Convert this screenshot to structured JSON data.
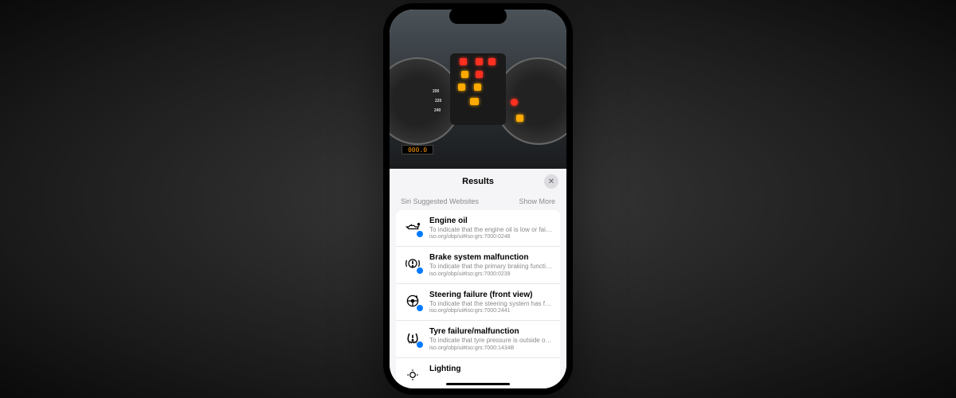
{
  "sheet": {
    "title": "Results",
    "section_label": "Siri Suggested Websites",
    "show_more": "Show More"
  },
  "dashboard": {
    "odometer": "000.0",
    "ticks_left": [
      "200",
      "220",
      "240"
    ]
  },
  "results": [
    {
      "title": "Engine oil",
      "desc": "To indicate that the engine oil is low or fails...",
      "url": "iso.org/obp/ui#iso:grs:7000:0248"
    },
    {
      "title": "Brake system malfunction",
      "desc": "To indicate that the primary braking function...",
      "url": "iso.org/obp/ui#iso:grs:7000:0239"
    },
    {
      "title": "Steering failure (front view)",
      "desc": "To indicate that the steering system has fail...",
      "url": "iso.org/obp/ui#iso:grs:7000:2441"
    },
    {
      "title": "Tyre failure/malfunction",
      "desc": "To indicate that tyre pressure is outside of n...",
      "url": "iso.org/obp/ui#iso:grs:7000:1434B"
    },
    {
      "title": "Lighting",
      "desc": "",
      "url": ""
    }
  ]
}
